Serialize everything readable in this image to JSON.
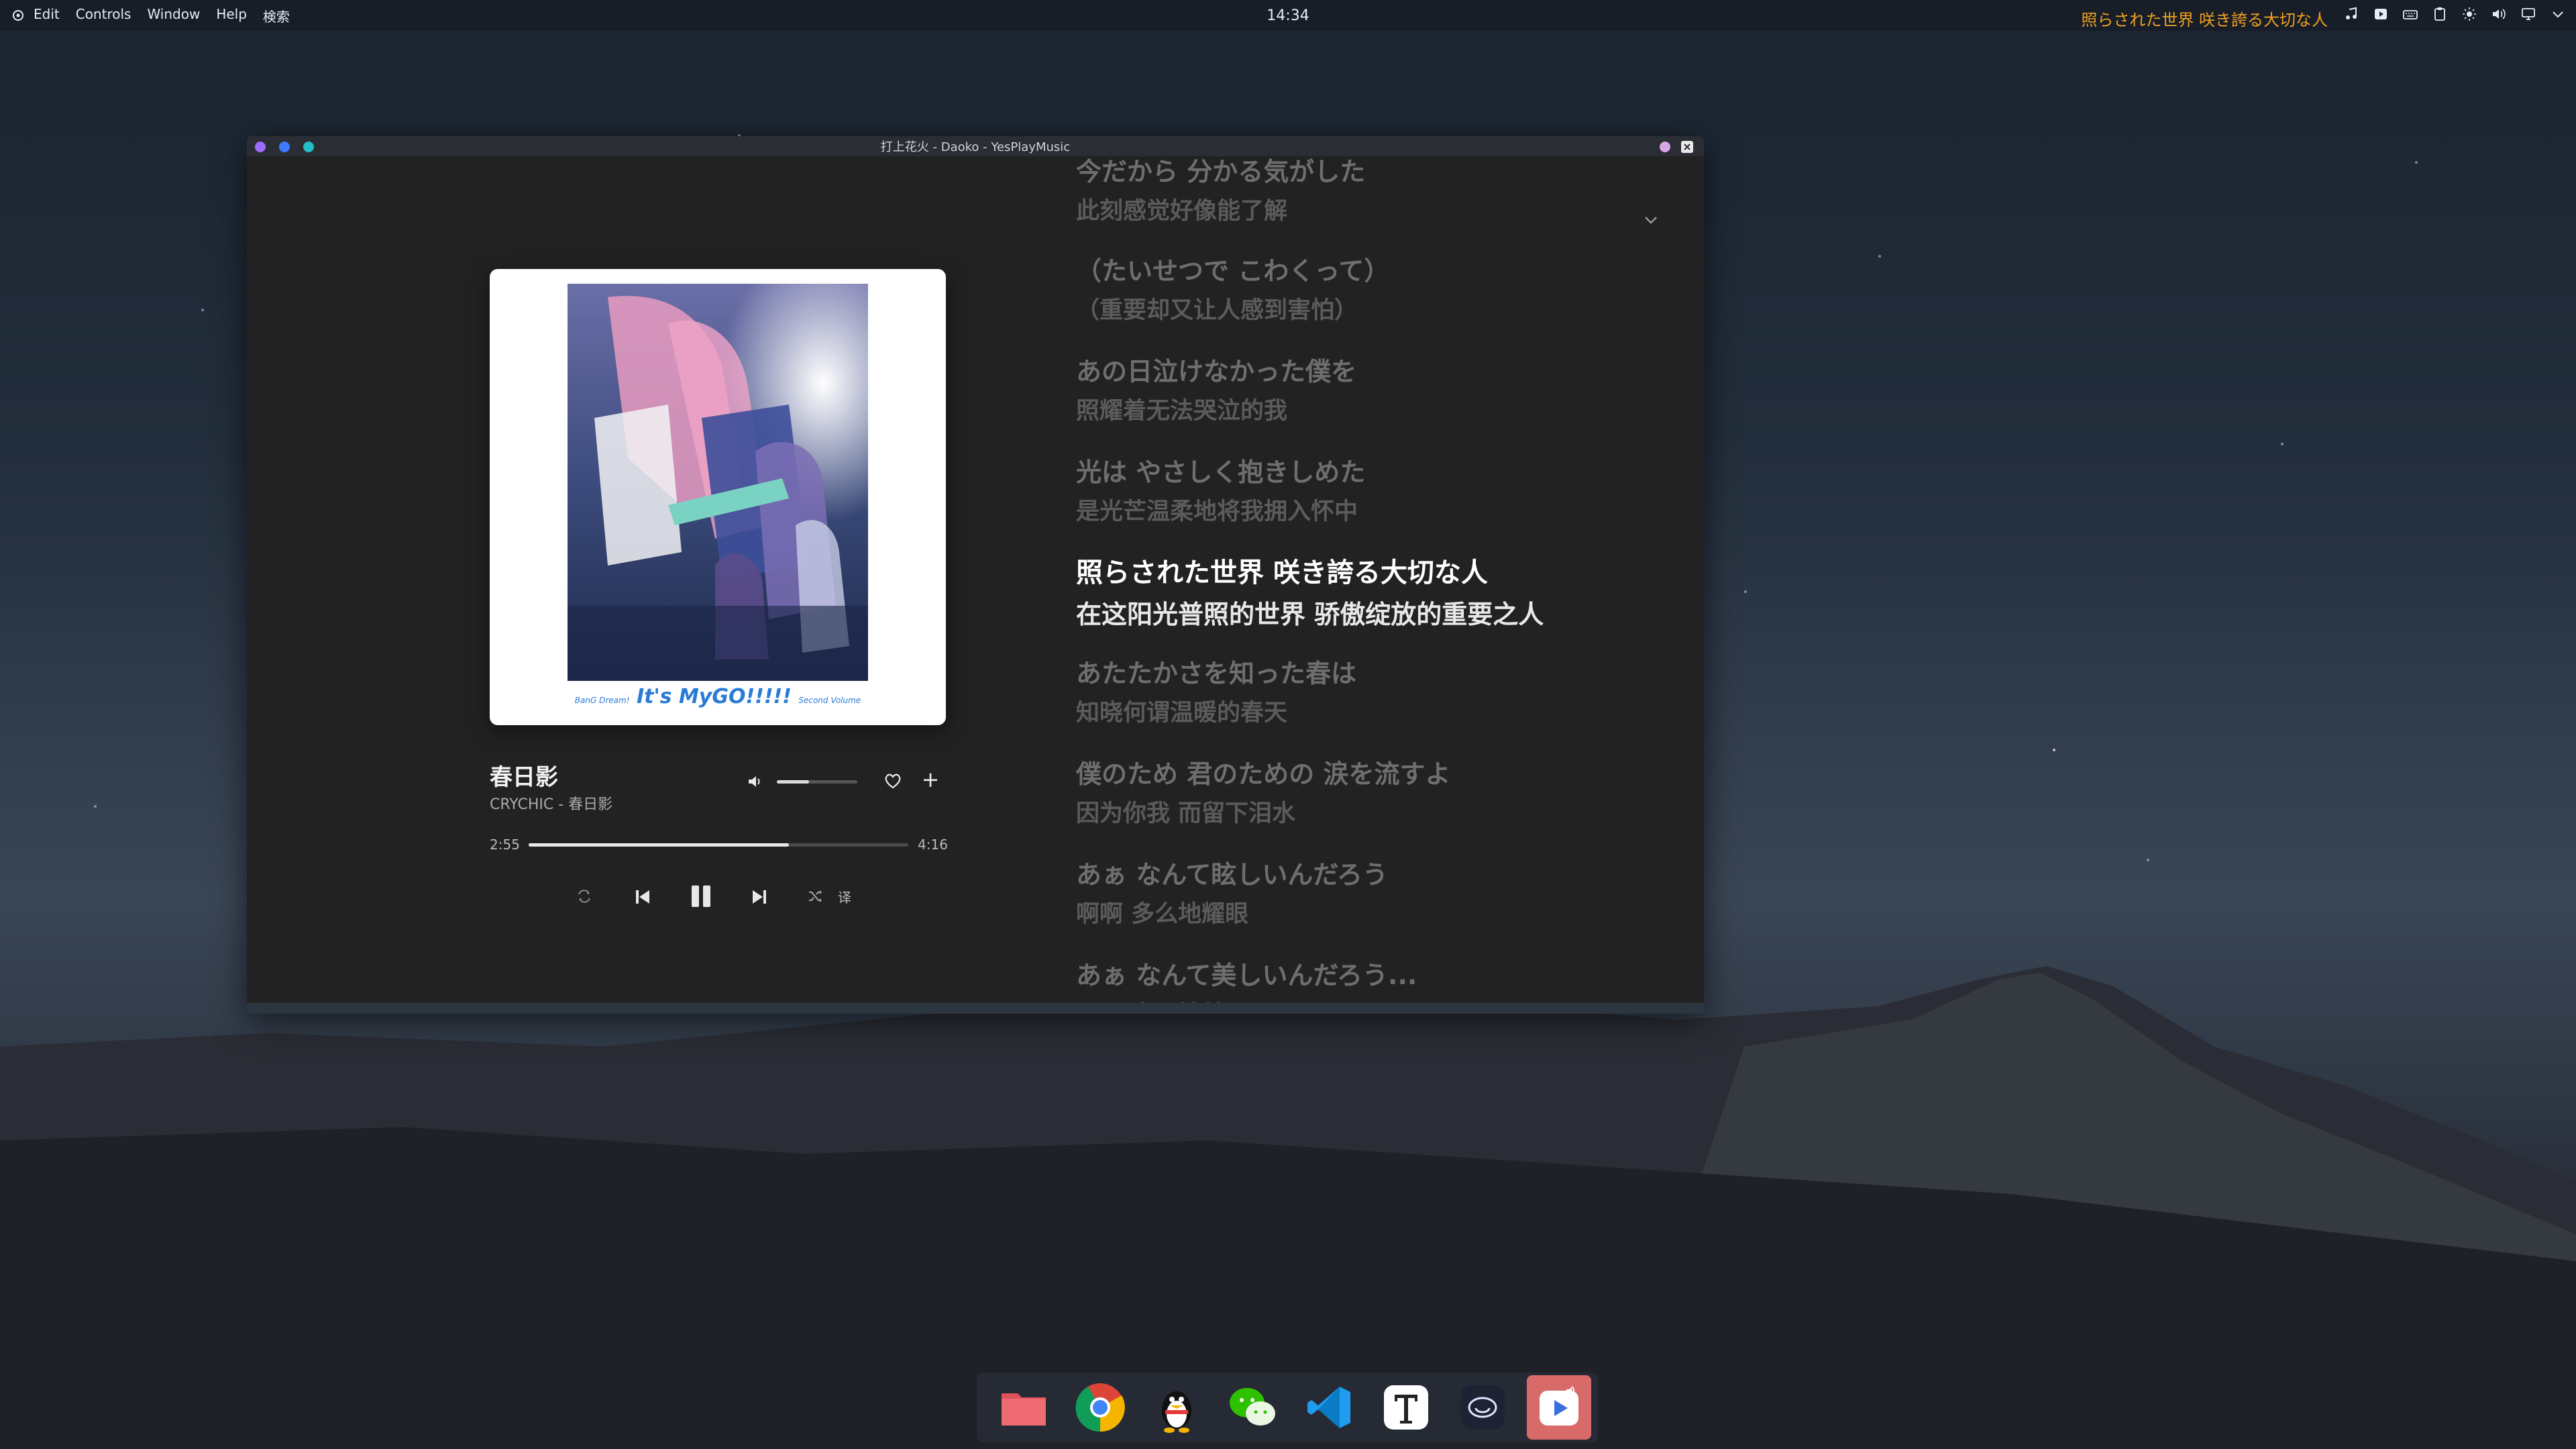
{
  "topbar": {
    "menu": [
      "Edit",
      "Controls",
      "Window",
      "Help",
      "検索"
    ],
    "clock": "14:34",
    "lyric_ticker": "照らされた世界 咲き誇る大切な人"
  },
  "window": {
    "title": "打上花火 - Daoko - YesPlayMusic"
  },
  "player": {
    "album_logo": "It's MyGO!!!!!",
    "album_logo_left": "BanG Dream!",
    "album_logo_right": "Second Volume",
    "song_title": "春日影",
    "song_subtitle": "CRYCHIC - 春日影",
    "time_current": "2:55",
    "time_total": "4:16",
    "progress": 0.685,
    "volume": 0.4,
    "translate_label": "译"
  },
  "lyrics": [
    {
      "jp": "今だから 分かる気がした",
      "cn": "此刻感觉好像能了解"
    },
    {
      "jp": "（たいせつで こわくって）",
      "cn": "（重要却又让人感到害怕）"
    },
    {
      "jp": "あの日泣けなかった僕を",
      "cn": "照耀着无法哭泣的我"
    },
    {
      "jp": "光は やさしく抱きしめた",
      "cn": "是光芒温柔地将我拥入怀中"
    },
    {
      "jp": "照らされた世界 咲き誇る大切な人",
      "cn": "在这阳光普照的世界 骄傲绽放的重要之人",
      "active": true
    },
    {
      "jp": "あたたかさを知った春は",
      "cn": "知晓何谓温暖的春天"
    },
    {
      "jp": "僕のため 君のための 涙を流すよ",
      "cn": "因为你我 而留下泪水"
    },
    {
      "jp": "あぁ なんて眩しいんだろう",
      "cn": "啊啊 多么地耀眼"
    },
    {
      "jp": "あぁ なんて美しいんだろう...",
      "cn": "啊啊 多么地美丽"
    }
  ],
  "colors": {
    "ticker": "#f0a020",
    "window_bg": "#222222",
    "active_lyric": "#ffffff"
  },
  "dock": [
    "folder-icon",
    "chrome-icon",
    "qq-icon",
    "wechat-icon",
    "vscode-icon",
    "typora-icon",
    "gpt-icon",
    "yesplaymusic-icon"
  ]
}
